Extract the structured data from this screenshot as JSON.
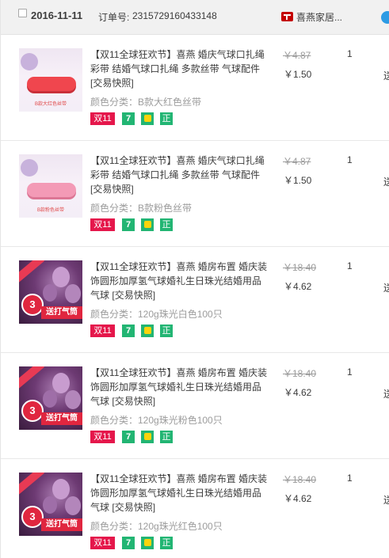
{
  "header": {
    "date": "2016-11-11",
    "order_label": "订单号:",
    "order_number": "2315729160433148",
    "shop_name": "喜燕家居..."
  },
  "items": [
    {
      "title": "【双11全球狂欢节】喜燕 婚庆气球口扎绳 彩带 结婚气球口扎绳 多款丝带 气球配件",
      "snapshot": "[交易快照]",
      "sku": "颜色分类：B款大红色丝带",
      "orig_price": "￥4.87",
      "price": "￥1.50",
      "qty": "1",
      "action": "送",
      "image_caption": "B款大红色丝带"
    },
    {
      "title": "【双11全球狂欢节】喜燕 婚庆气球口扎绳 彩带 结婚气球口扎绳 多款丝带 气球配件",
      "snapshot": "[交易快照]",
      "sku": "颜色分类：B款粉色丝带",
      "orig_price": "￥4.87",
      "price": "￥1.50",
      "qty": "1",
      "action": "送",
      "image_caption": "B款粉色丝带"
    },
    {
      "title": "【双11全球狂欢节】喜燕 婚房布置 婚庆装饰圆形加厚氢气球婚礼生日珠光结婚用品气球",
      "snapshot": "[交易快照]",
      "sku": "颜色分类：120g珠光白色100只",
      "orig_price": "￥18.40",
      "price": "￥4.62",
      "qty": "1",
      "action": "送",
      "badge_num": "3",
      "badge_text": "送打气筒"
    },
    {
      "title": "【双11全球狂欢节】喜燕 婚房布置 婚庆装饰圆形加厚氢气球婚礼生日珠光结婚用品气球",
      "snapshot": "[交易快照]",
      "sku": "颜色分类：120g珠光粉色100只",
      "orig_price": "￥18.40",
      "price": "￥4.62",
      "qty": "1",
      "action": "送",
      "badge_num": "3",
      "badge_text": "送打气筒"
    },
    {
      "title": "【双11全球狂欢节】喜燕 婚房布置 婚庆装饰圆形加厚氢气球婚礼生日珠光结婚用品气球",
      "snapshot": "[交易快照]",
      "sku": "颜色分类：120g珠光红色100只",
      "orig_price": "￥18.40",
      "price": "￥4.62",
      "qty": "1",
      "action": "送",
      "badge_num": "3",
      "badge_text": "送打气筒"
    }
  ],
  "tags": {
    "double11": "双11",
    "seven": "7",
    "zheng": "正"
  },
  "colors": {
    "header_bg": "#f1f1f1",
    "double11_tag": "#e5174b",
    "service_tag": "#22b573",
    "tmall_red": "#c40000",
    "muted_text": "#9c9c9c"
  }
}
